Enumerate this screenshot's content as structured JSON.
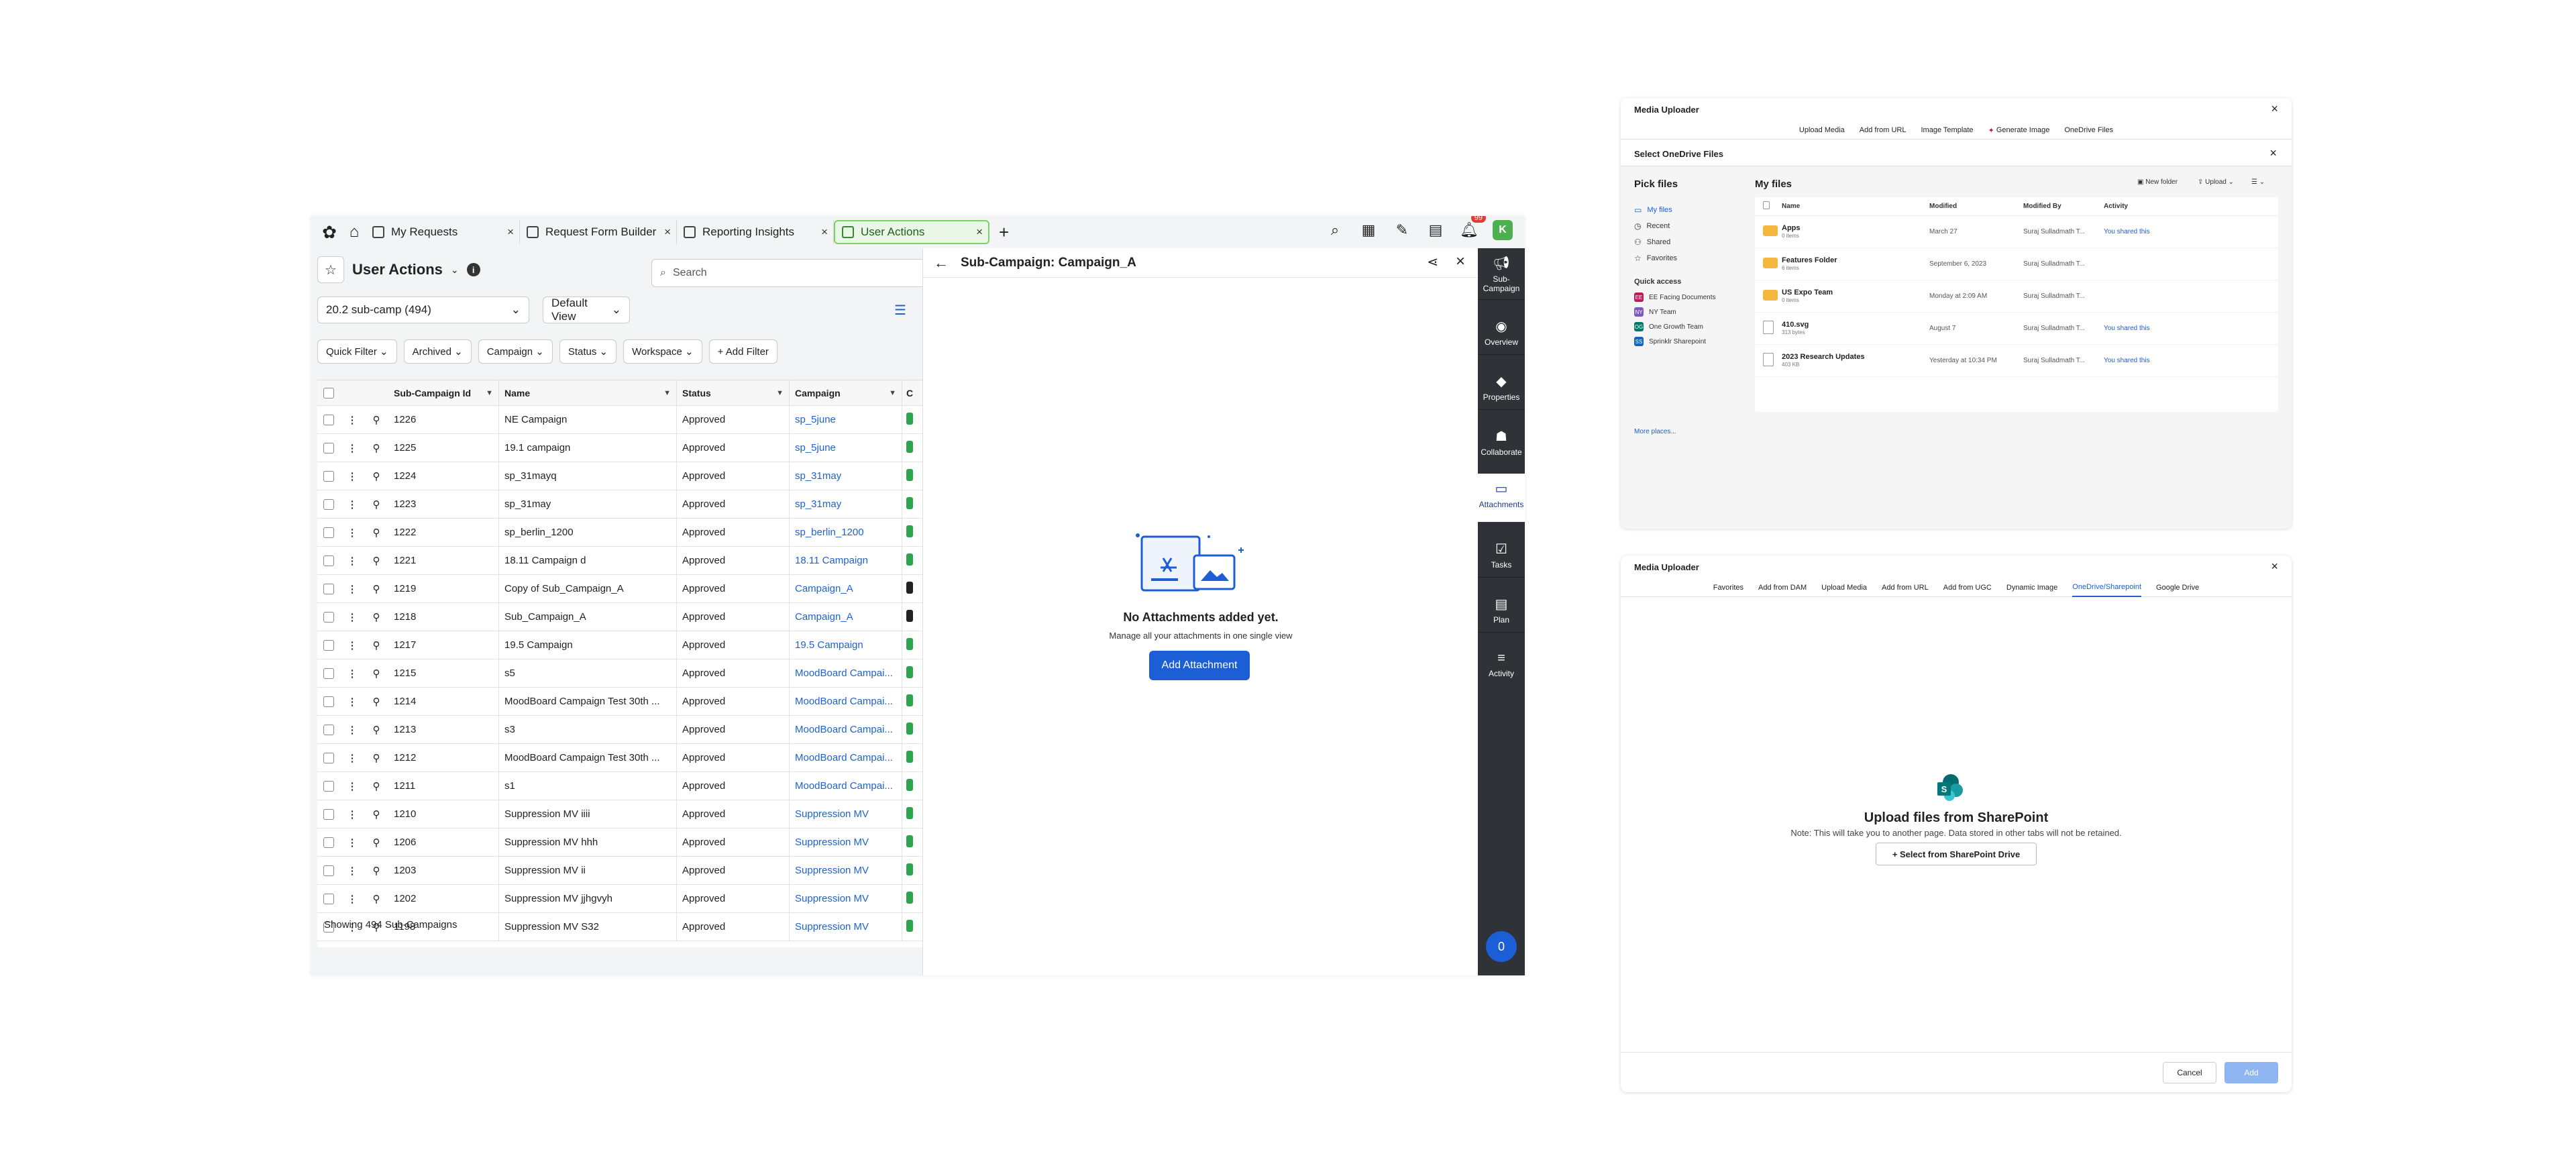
{
  "app": {
    "tabs": [
      {
        "label": "My Requests"
      },
      {
        "label": "Request Form Builder"
      },
      {
        "label": "Reporting Insights"
      },
      {
        "label": "User Actions"
      }
    ],
    "notification_count": "99",
    "avatar_letter": "K",
    "title": "User Actions",
    "search_placeholder": "Search",
    "view_select": "20.2 sub-camp (494)",
    "default_view": "Default View",
    "filters": [
      "Quick Filter",
      "Archived",
      "Campaign",
      "Status",
      "Workspace"
    ],
    "add_filter": "+ Add Filter",
    "columns": [
      "Sub-Campaign Id",
      "Name",
      "Status",
      "Campaign"
    ],
    "rows": [
      {
        "id": "1226",
        "name": "NE Campaign",
        "status": "Approved",
        "campaign": "sp_5june"
      },
      {
        "id": "1225",
        "name": "19.1 campaign",
        "status": "Approved",
        "campaign": "sp_5june"
      },
      {
        "id": "1224",
        "name": "sp_31mayq",
        "status": "Approved",
        "campaign": "sp_31may"
      },
      {
        "id": "1223",
        "name": "sp_31may",
        "status": "Approved",
        "campaign": "sp_31may"
      },
      {
        "id": "1222",
        "name": "sp_berlin_1200",
        "status": "Approved",
        "campaign": "sp_berlin_1200"
      },
      {
        "id": "1221",
        "name": "18.11 Campaign d",
        "status": "Approved",
        "campaign": "18.11 Campaign"
      },
      {
        "id": "1219",
        "name": "Copy of Sub_Campaign_A",
        "status": "Approved",
        "campaign": "Campaign_A"
      },
      {
        "id": "1218",
        "name": "Sub_Campaign_A",
        "status": "Approved",
        "campaign": "Campaign_A"
      },
      {
        "id": "1217",
        "name": "19.5 Campaign",
        "status": "Approved",
        "campaign": "19.5 Campaign"
      },
      {
        "id": "1215",
        "name": "s5",
        "status": "Approved",
        "campaign": "MoodBoard Campai..."
      },
      {
        "id": "1214",
        "name": "MoodBoard Campaign Test 30th ...",
        "status": "Approved",
        "campaign": "MoodBoard Campai..."
      },
      {
        "id": "1213",
        "name": "s3",
        "status": "Approved",
        "campaign": "MoodBoard Campai..."
      },
      {
        "id": "1212",
        "name": "MoodBoard Campaign Test 30th ...",
        "status": "Approved",
        "campaign": "MoodBoard Campai..."
      },
      {
        "id": "1211",
        "name": "s1",
        "status": "Approved",
        "campaign": "MoodBoard Campai..."
      },
      {
        "id": "1210",
        "name": "Suppression MV iiii",
        "status": "Approved",
        "campaign": "Suppression MV"
      },
      {
        "id": "1206",
        "name": "Suppression MV hhh",
        "status": "Approved",
        "campaign": "Suppression MV"
      },
      {
        "id": "1203",
        "name": "Suppression MV ii",
        "status": "Approved",
        "campaign": "Suppression MV"
      },
      {
        "id": "1202",
        "name": "Suppression MV jjhgvyh",
        "status": "Approved",
        "campaign": "Suppression MV"
      },
      {
        "id": "1198",
        "name": "Suppression MV S32",
        "status": "Approved",
        "campaign": "Suppression MV"
      }
    ],
    "footer": "Showing 494 Sub-Campaigns"
  },
  "detail": {
    "title": "Sub-Campaign: Campaign_A",
    "empty_title": "No Attachments added yet.",
    "empty_sub": "Manage all your attachments in one single view",
    "add_button": "Add Attachment"
  },
  "rail": {
    "items": [
      "Sub-Campaign",
      "Overview",
      "Properties",
      "Collaborate",
      "Attachments",
      "Tasks",
      "Plan",
      "Activity"
    ],
    "bottom_badge": "0"
  },
  "uploader1": {
    "title": "Media Uploader",
    "tabs": [
      "Upload Media",
      "Add from URL",
      "Image Template",
      "Generate Image",
      "OneDrive Files"
    ],
    "dialog_title": "Select OneDrive Files",
    "pick": "Pick files",
    "nav": [
      "My files",
      "Recent",
      "Shared",
      "Favorites"
    ],
    "quick_access_label": "Quick access",
    "quick_access": [
      {
        "abbr": "EE",
        "label": "EE Facing Documents",
        "color": "#c2185b"
      },
      {
        "abbr": "NY",
        "label": "NY Team",
        "color": "#7e57c2"
      },
      {
        "abbr": "OG",
        "label": "One Growth Team",
        "color": "#00796b"
      },
      {
        "abbr": "SS",
        "label": "Sprinklr Sharepoint",
        "color": "#1565c0"
      }
    ],
    "more_places": "More places...",
    "my_files": "My files",
    "new_folder": "New folder",
    "upload": "Upload",
    "file_columns": [
      "Name",
      "Modified",
      "Modified By",
      "Activity"
    ],
    "files": [
      {
        "name": "Apps",
        "meta": "0 items",
        "modified": "March 27",
        "by": "Suraj Sulladmath T...",
        "activity": "You shared this",
        "kind": "folder"
      },
      {
        "name": "Features Folder",
        "meta": "6 items",
        "modified": "September 6, 2023",
        "by": "Suraj Sulladmath T...",
        "activity": "",
        "kind": "folder"
      },
      {
        "name": "US Expo Team",
        "meta": "0 items",
        "modified": "Monday at 2:09 AM",
        "by": "Suraj Sulladmath T...",
        "activity": "",
        "kind": "folder"
      },
      {
        "name": "410.svg",
        "meta": "313 bytes",
        "modified": "August 7",
        "by": "Suraj Sulladmath T...",
        "activity": "You shared this",
        "kind": "file"
      },
      {
        "name": "2023 Research Updates",
        "meta": "403 KB",
        "modified": "Yesterday at 10:34 PM",
        "by": "Suraj Sulladmath T...",
        "activity": "You shared this",
        "kind": "file"
      }
    ]
  },
  "uploader2": {
    "title": "Media Uploader",
    "tabs": [
      "Favorites",
      "Add from DAM",
      "Upload Media",
      "Add from URL",
      "Add from UGC",
      "Dynamic Image",
      "OneDrive/Sharepoint",
      "Google Drive"
    ],
    "active_tab": "OneDrive/Sharepoint",
    "heading": "Upload files from SharePoint",
    "note": "Note: This will take you to another page. Data stored in other tabs will not be retained.",
    "select_button": "+ Select from SharePoint Drive",
    "cancel": "Cancel",
    "add": "Add"
  }
}
